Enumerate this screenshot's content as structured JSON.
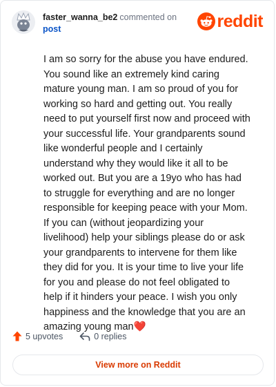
{
  "comment": {
    "username": "faster_wanna_be2",
    "action_text": "commented on",
    "post_link": "post",
    "text": "I am so sorry for the abuse you have endured. You sound like an extremely kind caring mature young man. I am so proud of you for working so hard and getting out. You really need to put yourself first now and proceed with your successful life. Your grandparents sound like wonderful people and I certainly understand why they would like it all to be worked out. But you are a 19yo who has had to struggle for everything and are no longer responsible for keeping peace with your Mom. If you can (without jeopardizing your livelihood) help your siblings please do or ask your grandparents to intervene for them like they did for you. It is your time to live your life for you and please do not feel obligated to help if it hinders your peace. I wish you only happiness and the knowledge that you are an amazing young man❤️"
  },
  "brand": {
    "name": "reddit",
    "color": "#ff4500"
  },
  "stats": {
    "upvotes": "5 upvotes",
    "replies": "0 replies"
  },
  "cta": {
    "label": "View more on Reddit"
  },
  "icons": {
    "avatar": "avatar",
    "brand": "reddit-snoo-icon",
    "upvote": "upvote-arrow-icon",
    "reply": "reply-arrow-icon"
  }
}
